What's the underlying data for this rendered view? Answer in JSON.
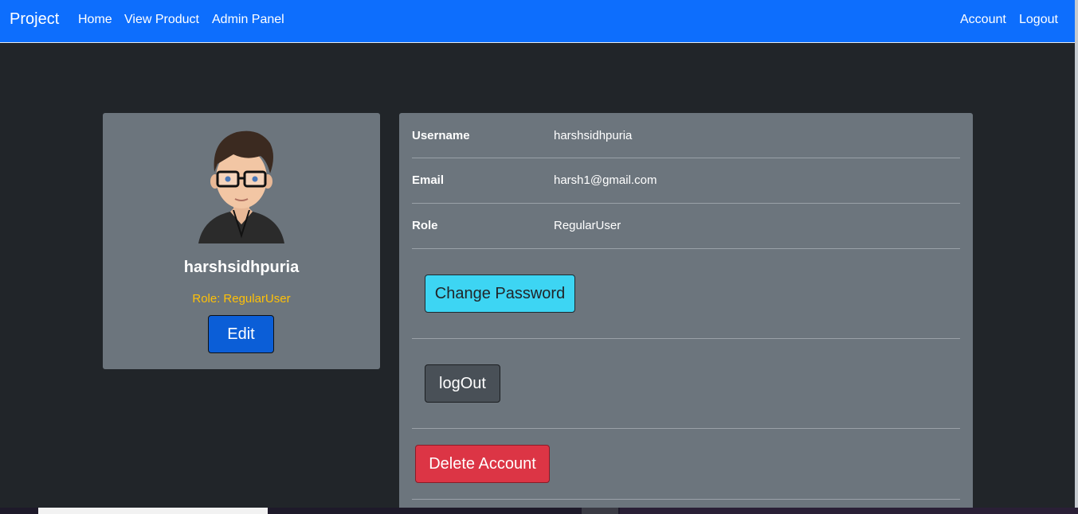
{
  "navbar": {
    "brand": "Project",
    "links_left": [
      "Home",
      "View Product",
      "Admin Panel"
    ],
    "links_right": [
      "Account",
      "Logout"
    ]
  },
  "profile": {
    "name": "harshsidhpuria",
    "role_label": "Role:",
    "role_value": "RegularUser",
    "edit_label": "Edit",
    "avatar_icon": "avatar-icon"
  },
  "details": {
    "rows": [
      {
        "label": "Username",
        "value": "harshsidhpuria"
      },
      {
        "label": "Email",
        "value": "harsh1@gmail.com"
      },
      {
        "label": "Role",
        "value": "RegularUser"
      }
    ],
    "change_password_label": "Change Password",
    "logout_label": "logOut",
    "delete_label": "Delete Account"
  },
  "colors": {
    "navbar": "#0d6efd",
    "background": "#212529",
    "card": "#6c757d",
    "role_text": "#ffc107",
    "edit_button": "#0b5ed7",
    "change_password_button": "#3dd5f3",
    "logout_button": "#495057",
    "delete_button": "#dc3545"
  }
}
